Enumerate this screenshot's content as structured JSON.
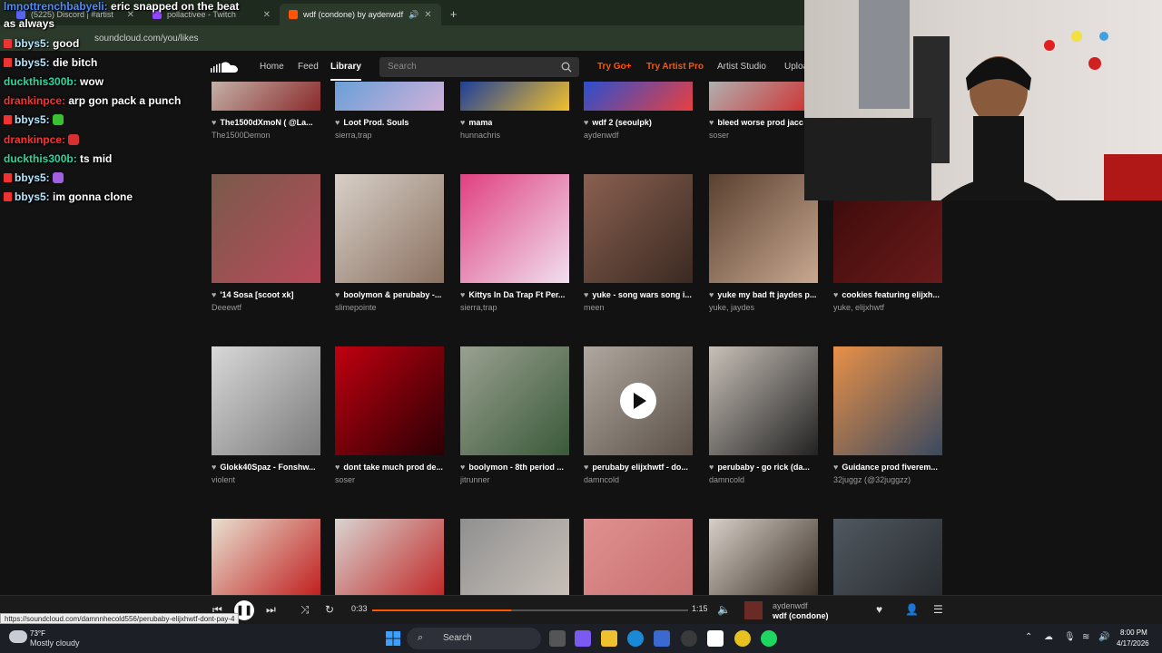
{
  "browser": {
    "tabs": [
      {
        "label": "(5225) Discord | #artist",
        "color": "#5865f2"
      },
      {
        "label": "pollactivee - Twitch",
        "color": "#9146ff"
      },
      {
        "label": "wdf (condone) by aydenwdf",
        "color": "#ff5500"
      }
    ],
    "url": "soundcloud.com/you/likes"
  },
  "nav": {
    "home": "Home",
    "feed": "Feed",
    "library": "Library",
    "search_placeholder": "Search",
    "try_go": "Try Go+",
    "try_artist_pro": "Try Artist Pro",
    "artist_studio": "Artist Studio",
    "upload": "Upload"
  },
  "tracks_row0": [
    {
      "title": "The1500dXmoN ( @La...",
      "artist": "The1500Demon",
      "c1": "#c4b0a8",
      "c2": "#8a2a2a"
    },
    {
      "title": "Loot Prod. Souls",
      "artist": "sierra,trap",
      "c1": "#6aa0d8",
      "c2": "#d0b0d8"
    },
    {
      "title": "mama",
      "artist": "hunnachris",
      "c1": "#1e3f9a",
      "c2": "#f2c02a"
    },
    {
      "title": "wdf 2 (seoulpk)",
      "artist": "aydenwdf",
      "c1": "#2a4fd0",
      "c2": "#e84040"
    },
    {
      "title": "bleed worse prod jacc",
      "artist": "soser",
      "c1": "#b0b0b0",
      "c2": "#d02a2a"
    }
  ],
  "tracks_row1": [
    {
      "title": "'14 Sosa [scoot xk]",
      "artist": "Deeewtf",
      "c1": "#7a5a4a",
      "c2": "#b84a5a"
    },
    {
      "title": "boolymon & perubaby -...",
      "artist": "slimepointe",
      "c1": "#d8d0c8",
      "c2": "#8a7060"
    },
    {
      "title": "Kittys In Da Trap Ft Per...",
      "artist": "sierra,trap",
      "c1": "#e04080",
      "c2": "#f0e0f0"
    },
    {
      "title": "yuke - song wars song i...",
      "artist": "meen",
      "c1": "#8a6050",
      "c2": "#3a2a22"
    },
    {
      "title": "yuke my bad ft jaydes p...",
      "artist": "yuke, jaydes",
      "c1": "#5a4030",
      "c2": "#c8a890"
    },
    {
      "title": "cookies featuring elijxh...",
      "artist": "yuke, elijxhwtf",
      "c1": "#3a0a0a",
      "c2": "#6a1a1a"
    }
  ],
  "tracks_row2": [
    {
      "title": "Glokk40Spaz - Fonshw...",
      "artist": "violent",
      "c1": "#d8d8d8",
      "c2": "#7a7a7a"
    },
    {
      "title": "dont take much prod de...",
      "artist": "soser",
      "c1": "#c00010",
      "c2": "#2a0004"
    },
    {
      "title": "boolymon - 8th period ...",
      "artist": "jitrunner",
      "c1": "#9aa090",
      "c2": "#3a5a3a"
    },
    {
      "title": "perubaby elijxhwtf - do...",
      "artist": "damncold",
      "c1": "#b0a8a0",
      "c2": "#5a5048"
    },
    {
      "title": "perubaby - go rick (da...",
      "artist": "damncold",
      "c1": "#c8c0b8",
      "c2": "#222222"
    },
    {
      "title": "Guidance prod fiverem...",
      "artist": "32juggz (@32juggzz)",
      "c1": "#e89048",
      "c2": "#3a4a60"
    }
  ],
  "tracks_row3": [
    {
      "c1": "#e8e0d0",
      "c2": "#c02020"
    },
    {
      "c1": "#d8d4d0",
      "c2": "#c02828"
    },
    {
      "c1": "#909090",
      "c2": "#c8c0b8"
    },
    {
      "c1": "#e09090",
      "c2": "#c87070"
    },
    {
      "c1": "#d8d0c8",
      "c2": "#3a3028"
    },
    {
      "c1": "#505860",
      "c2": "#282c30"
    }
  ],
  "chat": [
    {
      "user": "lmnottrenchbabyeli",
      "user_color": "#4a8cff",
      "msg": "eric snapped on the beat"
    },
    {
      "user": "",
      "user_color": "#fff",
      "msg": "as always"
    },
    {
      "user": "bbys5",
      "user_color": "#b4e4ff",
      "msg": "good",
      "badge": true
    },
    {
      "user": "bbys5",
      "user_color": "#b4e4ff",
      "msg": "die bitch",
      "badge": true
    },
    {
      "user": "drankinpce",
      "user_color": "#ff3030",
      "msg": "arp gon pack a punch"
    },
    {
      "user": "duckthis300b",
      "user_color": "#28d8a0",
      "msg": "wow"
    },
    {
      "user": "bbys5",
      "user_color": "#b4e4ff",
      "msg": "",
      "badge": true,
      "emote": "#3ac030"
    },
    {
      "user": "drankinpce",
      "user_color": "#ff3030",
      "msg": "",
      "emote": "#d83030"
    },
    {
      "user": "duckthis300b",
      "user_color": "#28d8a0",
      "msg": "ts mid"
    },
    {
      "user": "bbys5",
      "user_color": "#b4e4ff",
      "msg": "",
      "badge": true,
      "emote": "#a060e0"
    },
    {
      "user": "bbys5",
      "user_color": "#b4e4ff",
      "msg": "im gonna clone",
      "badge": true
    }
  ],
  "player": {
    "elapsed": "0:33",
    "duration": "1:15",
    "progress": 0.44,
    "artist": "aydenwdf",
    "title": "wdf (condone)"
  },
  "status_url": "https://soundcloud.com/damnnhecold556/perubaby-elijxhwtf-dont-pay-4",
  "taskbar": {
    "temp": "73°F",
    "weather": "Mostly cloudy",
    "search": "Search",
    "time": "8:00 PM",
    "date": "4/17/2026"
  }
}
